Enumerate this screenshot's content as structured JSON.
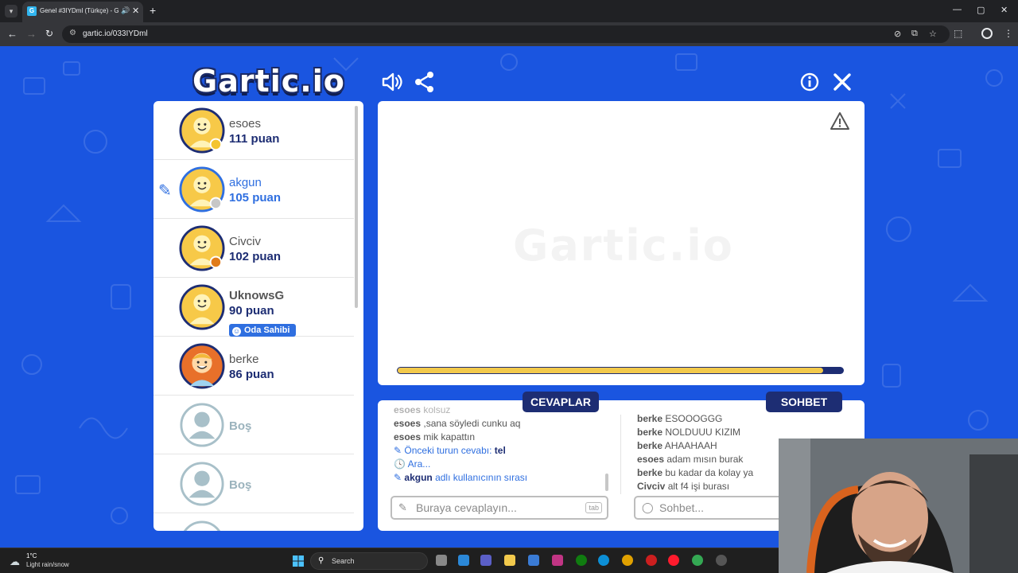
{
  "browser": {
    "tab_title": "Genel #3IYDml (Türkçe) - G",
    "url": "gartic.io/033IYDml",
    "window_controls": [
      "—",
      "▢",
      "✕"
    ]
  },
  "header": {
    "logo_text": "Gartic.io",
    "icons": [
      "volume-icon",
      "share-icon",
      "info-icon",
      "close-icon"
    ]
  },
  "players": [
    {
      "name": "esoes",
      "score": "111 puan",
      "status_color": "#f4c430"
    },
    {
      "name": "akgun",
      "score": "105 puan",
      "status_color": "#c7c7c7"
    },
    {
      "name": "Civciv",
      "score": "102 puan",
      "status_color": "#e07b1a"
    },
    {
      "name": "UknowsG",
      "score": "90 puan",
      "badge": "Oda Sahibi"
    },
    {
      "name": "berke",
      "score": "86 puan"
    },
    {
      "name": "Boş"
    },
    {
      "name": "Boş"
    }
  ],
  "canvas": {
    "watermark": "Gartic.io",
    "timer_fraction": 0.955
  },
  "answers": {
    "tab_label": "CEVAPLAR",
    "messages": [
      {
        "user": "esoes",
        "text": "kolsuz"
      },
      {
        "user": "esoes",
        "text": ",sana söyledi cunku aq"
      },
      {
        "user": "esoes",
        "text": "mik kapattın"
      }
    ],
    "system": {
      "prev_answer_label": "Önceki turun cevabı:",
      "prev_answer": "tel",
      "searching": "Ara...",
      "turn_user": "akgun",
      "turn_text": "adlı kullanıcının sırası"
    },
    "placeholder": "Buraya cevaplayın...",
    "tab_hint": "tab"
  },
  "chat": {
    "tab_label": "SOHBET",
    "messages": [
      {
        "user": "berke",
        "text": "ESOOOGGG"
      },
      {
        "user": "berke",
        "text": "NOLDUUU KIZIM"
      },
      {
        "user": "berke",
        "text": "AHAAHAAH"
      },
      {
        "user": "esoes",
        "text": "adam mısın burak"
      },
      {
        "user": "berke",
        "text": "bu kadar da kolay ya"
      },
      {
        "user": "Civciv",
        "text": "alt f4 işi burası"
      }
    ],
    "placeholder": "Sohbet..."
  },
  "taskbar": {
    "temperature": "1°C",
    "condition": "Light rain/snow",
    "search_label": "Search"
  },
  "colors": {
    "page_bg": "#1a55e0",
    "navy": "#1d2d73",
    "accent_blue": "#2f6fe0",
    "timer_yellow": "#f2c94c"
  }
}
